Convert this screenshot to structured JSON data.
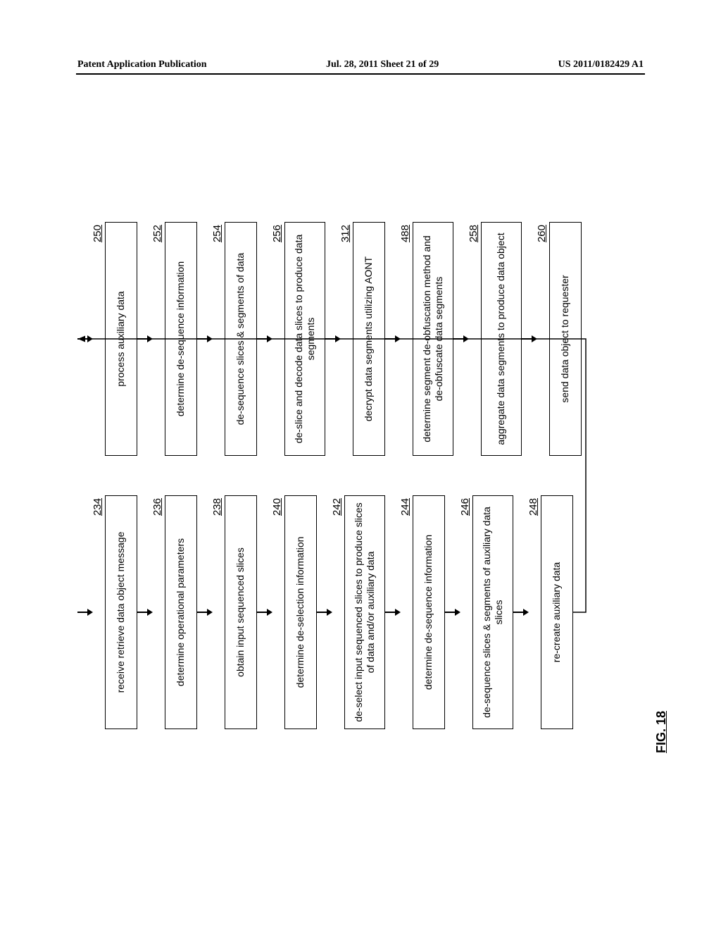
{
  "header": {
    "left": "Patent Application Publication",
    "center": "Jul. 28, 2011  Sheet 21 of 29",
    "right": "US 2011/0182429 A1"
  },
  "figure": {
    "label": "FIG. 18"
  },
  "left_steps": [
    {
      "num": "234",
      "text": "receive retrieve data object message"
    },
    {
      "num": "236",
      "text": "determine operational parameters"
    },
    {
      "num": "238",
      "text": "obtain input sequenced slices"
    },
    {
      "num": "240",
      "text": "determine de-selection information"
    },
    {
      "num": "242",
      "text": "de-select input sequenced slices to produce slices of data and/or auxiliary data"
    },
    {
      "num": "244",
      "text": "determine de-sequence information"
    },
    {
      "num": "246",
      "text": "de-sequence slices & segments of auxiliary data slices"
    },
    {
      "num": "248",
      "text": "re-create auxiliary data"
    }
  ],
  "right_steps": [
    {
      "num": "250",
      "text": "process auxiliary data"
    },
    {
      "num": "252",
      "text": "determine de-sequence information"
    },
    {
      "num": "254",
      "text": "de-sequence slices & segments of data"
    },
    {
      "num": "256",
      "text": "de-slice and decode data slices to produce data segments"
    },
    {
      "num": "312",
      "text": "decrypt data segments utilizing AONT"
    },
    {
      "num": "488",
      "text": "determine segment de-obfuscation method and de-obfuscate data segments"
    },
    {
      "num": "258",
      "text": "aggregate data segments to produce data object"
    },
    {
      "num": "260",
      "text": "send data object to requester"
    }
  ]
}
